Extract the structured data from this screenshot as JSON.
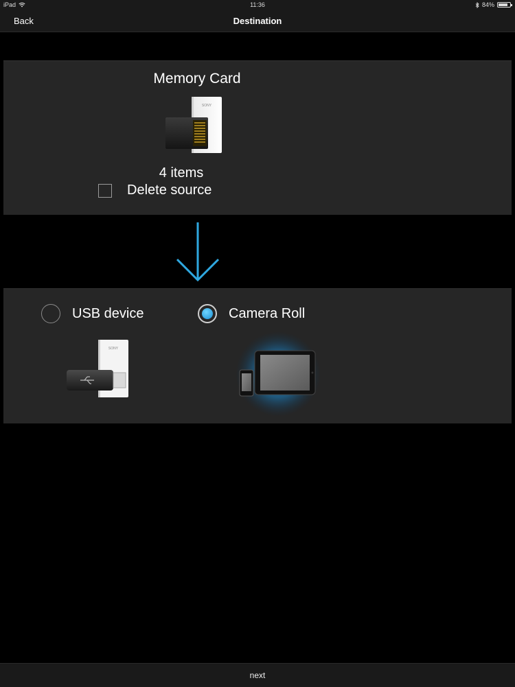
{
  "status_bar": {
    "device": "iPad",
    "time": "11:36",
    "battery_percent": "84%",
    "battery_level": 0.84
  },
  "nav": {
    "back_label": "Back",
    "title": "Destination"
  },
  "source": {
    "title": "Memory Card",
    "items_count": "4 items",
    "delete_label": "Delete source",
    "delete_checked": false,
    "card_brand": "SONY"
  },
  "destination": {
    "options": [
      {
        "label": "USB device",
        "selected": false,
        "icon": "usb-drive-icon",
        "brand": "SONY"
      },
      {
        "label": "Camera Roll",
        "selected": true,
        "icon": "ipad-iphone-icon"
      }
    ]
  },
  "colors": {
    "accent": "#2fa8e0",
    "panel": "#262626",
    "background": "#000000"
  },
  "bottom_bar": {
    "next_label": "next"
  }
}
